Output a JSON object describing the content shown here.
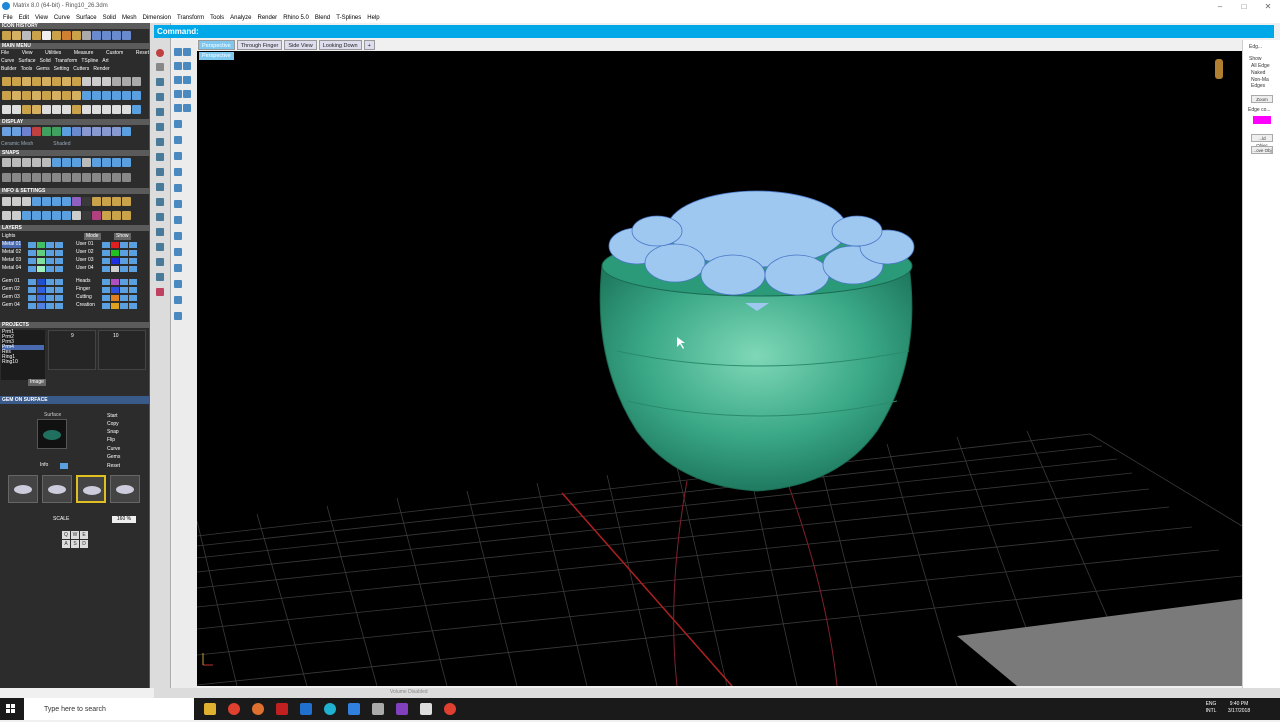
{
  "app": {
    "title": "Matrix 8.0 (64-bit) - Ring10_26.3dm",
    "window_controls": [
      "–",
      "□",
      "✕"
    ]
  },
  "menu": [
    "File",
    "Edit",
    "View",
    "Curve",
    "Surface",
    "Solid",
    "Mesh",
    "Dimension",
    "Transform",
    "Tools",
    "Analyze",
    "Render",
    "Rhino 5.0",
    "Blend",
    "T-Splines",
    "Help"
  ],
  "command": {
    "label": "Command:"
  },
  "left_panel": {
    "icon_history": "ICON HISTORY",
    "main_menu": "MAIN MENU",
    "main_menu_items": [
      "File",
      "View",
      "Utilities",
      "Measure",
      "Custom",
      "Reset"
    ],
    "main_menu_row2": [
      "Curve",
      "Surface",
      "Solid",
      "Transform",
      "TSpline",
      "Art"
    ],
    "main_menu_row3": [
      "Builder",
      "Tools",
      "Gems",
      "Setting",
      "Cutters",
      "Render"
    ],
    "display": "DISPLAY",
    "display_modes": [
      "Ceramic Mesh",
      "Shaded"
    ],
    "snaps": "SNAPS",
    "info_settings": "INFO & SETTINGS",
    "layers": "LAYERS",
    "layer_lights": "Lights",
    "layer_modes": [
      "Mode",
      "Show"
    ],
    "layers_left": [
      "Metal 01",
      "Metal 02",
      "Metal 03",
      "Metal 04",
      "Gem 01",
      "Gem 02",
      "Gem 03",
      "Gem 04"
    ],
    "layers_right": [
      "User 01",
      "User 02",
      "User 03",
      "User 04",
      "Heads",
      "Finger",
      "Cutting",
      "Creation"
    ],
    "layer_colors_right": [
      "#e02020",
      "#20c020",
      "#2030e0",
      "#d0d0d0",
      "#b050c0",
      "#3050e0",
      "#e08020",
      "#e0a020"
    ],
    "projects": "PROJECTS",
    "project_items": [
      "Prm1",
      "Prm2",
      "Prm3",
      "Prm4",
      "Res",
      "Ring1",
      "Ring10"
    ],
    "project_cols": [
      "9",
      "10"
    ],
    "project_buttons": [
      "Image"
    ],
    "gem_on_surface": "GEM ON SURFACE",
    "surface_label": "Surface",
    "info_label": "Info",
    "gem_options": [
      "Start",
      "Copy",
      "Snap",
      "Flip",
      "Curve",
      "Gems",
      "Reset"
    ],
    "scale_label": "SCALE",
    "scale_value": "160 %",
    "keys": [
      "Q",
      "W",
      "E",
      "A",
      "S",
      "D"
    ]
  },
  "viewport": {
    "tabs": [
      "Perspective",
      "Through Finger",
      "Side View",
      "Looking Down"
    ],
    "add_tab": "+",
    "active_label": "Perspective",
    "bg_color": "#000000",
    "accent": "#7ec8f0"
  },
  "right_panel": {
    "edge_label": "Edg...",
    "show_label": "Show",
    "show_options": [
      "All Edge",
      "Naked",
      "Non-Ma Edges"
    ],
    "zoom_btn": "Zoom",
    "edge_color_label": "Edge co...",
    "edge_color": "#ff00ff",
    "obj_btn": "...ld Objec",
    "remove_btn": "...ove Obj"
  },
  "status": {
    "text": "Volume Disabled"
  },
  "taskbar": {
    "search_placeholder": "Type here to search",
    "lang": "ENG",
    "lang2": "INTL",
    "time": "9:40 PM",
    "date": "3/17/2018"
  }
}
